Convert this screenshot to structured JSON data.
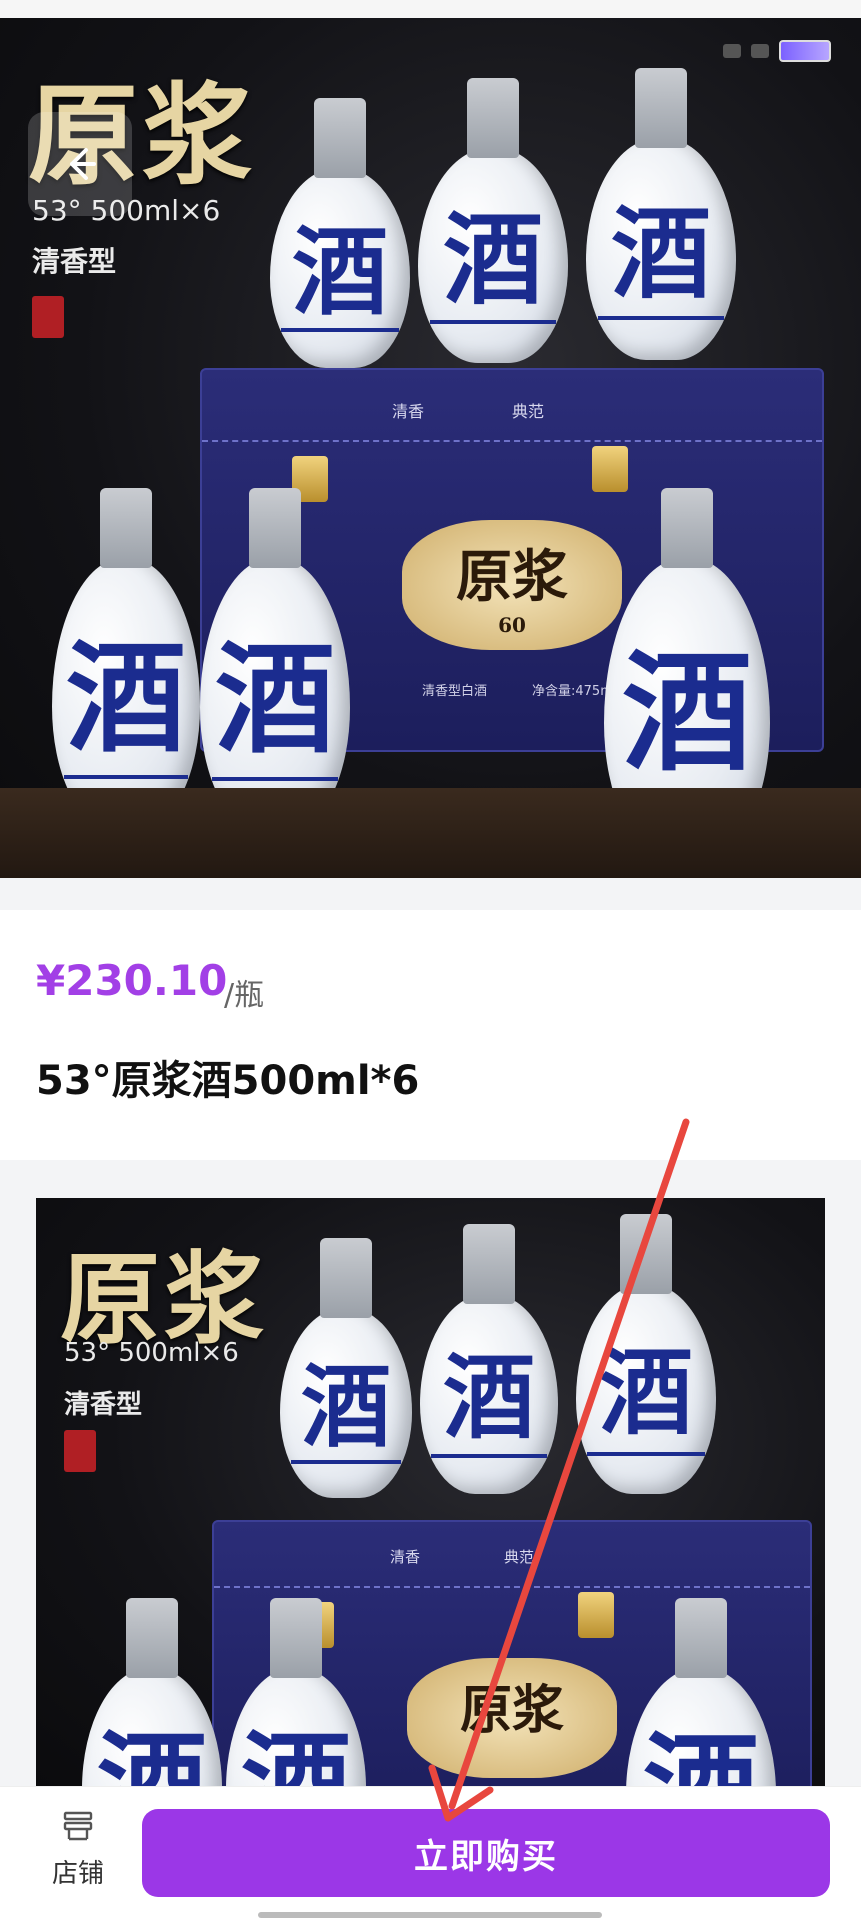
{
  "hero": {
    "brand": "原浆",
    "spec": "53° 500ml×6",
    "type": "清香型",
    "box_tag_left": "清香",
    "box_tag_right": "典范",
    "badge_brand": "原浆",
    "badge_num": "60",
    "box_line": "清香型白酒",
    "box_net": "净含量:475ml×6",
    "bottle_glyph": "酒"
  },
  "product": {
    "price": "¥230.10",
    "unit": "/瓶",
    "title": "53°原浆酒500ml*6"
  },
  "detail": {
    "brand": "原浆",
    "spec": "53° 500ml×6",
    "type": "清香型",
    "box_tag_left": "清香",
    "box_tag_right": "典范",
    "badge_brand": "原浆",
    "bottle_glyph": "酒"
  },
  "bottom_bar": {
    "shop_label": "店铺",
    "buy_label": "立即购买"
  },
  "colors": {
    "accent": "#9b37e7",
    "price": "#a23fe6",
    "annotation_arrow": "#e8473e"
  }
}
